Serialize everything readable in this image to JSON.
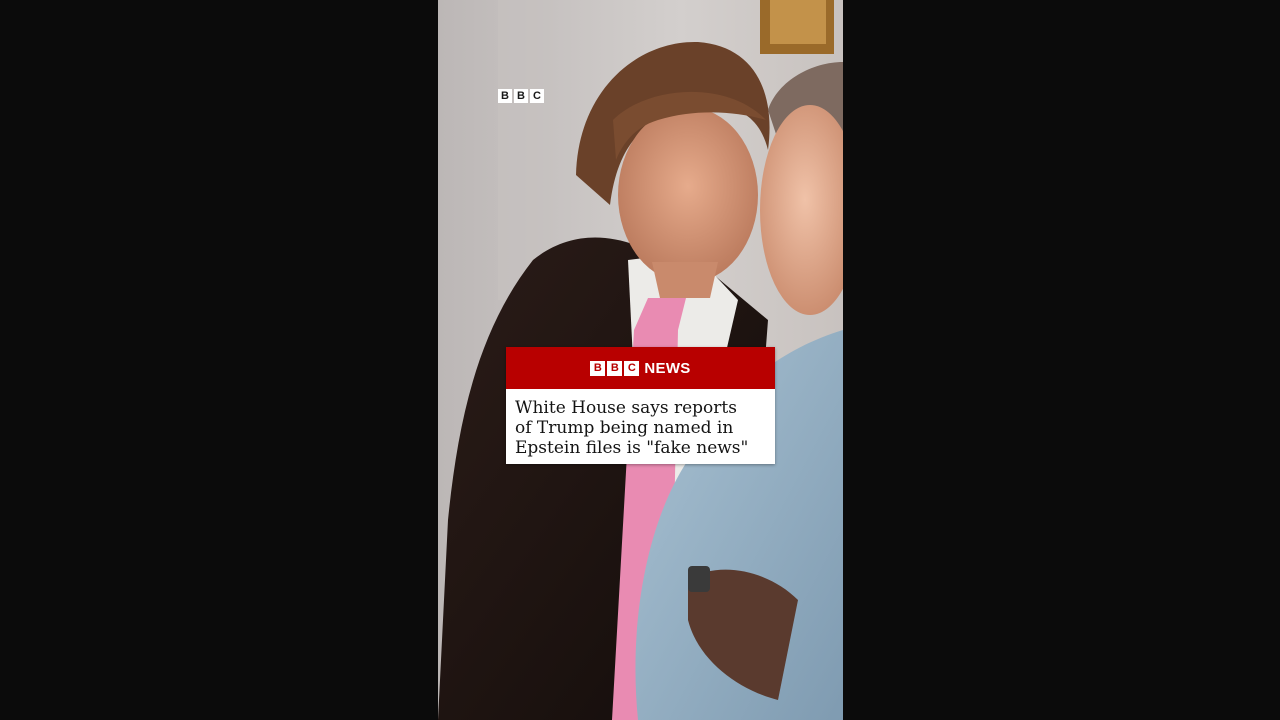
{
  "watermark": {
    "letters": [
      "B",
      "B",
      "C"
    ]
  },
  "news_card": {
    "brand_letters": [
      "B",
      "B",
      "C"
    ],
    "brand_word": "NEWS",
    "headline_lines": [
      "White House says reports",
      "of Trump being named in",
      "Epstein files is \"fake news\""
    ]
  },
  "colors": {
    "brand_red": "#b80000",
    "letterbox": "#0b0b0b",
    "card_body": "#ffffff"
  }
}
